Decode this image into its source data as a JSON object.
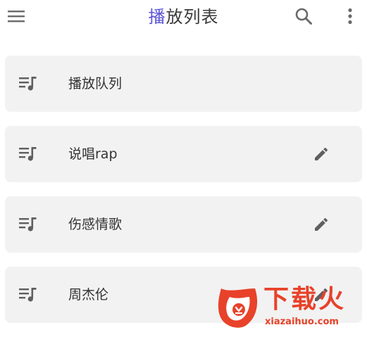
{
  "header": {
    "title_accent": "播",
    "title_rest": "放列表",
    "menu_icon": "hamburger-menu-icon",
    "search_icon": "search-icon",
    "more_icon": "more-vertical-icon"
  },
  "playlists": [
    {
      "label": "播放队列",
      "icon": "queue-music-icon",
      "editable": false
    },
    {
      "label": "说唱rap",
      "icon": "queue-music-icon",
      "editable": true
    },
    {
      "label": "伤感情歌",
      "icon": "queue-music-icon",
      "editable": true
    },
    {
      "label": "周杰伦",
      "icon": "queue-music-icon",
      "editable": true
    }
  ],
  "watermark": {
    "brand": "下载火",
    "url": "xiazaihuo.com"
  },
  "colors": {
    "accent": "#5b54d6",
    "card_bg": "#f2f2f2",
    "icon": "#5f5f5f",
    "watermark": "#e8422a"
  }
}
